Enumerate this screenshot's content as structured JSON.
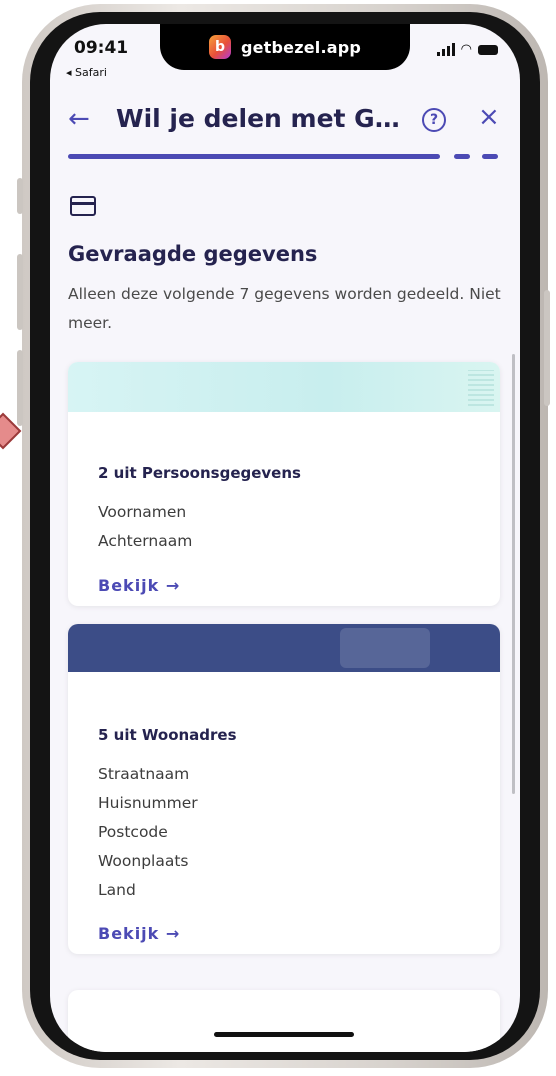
{
  "status_bar": {
    "time": "09:41",
    "back_app": "◂ Safari",
    "url_host": "getbezel.app"
  },
  "header": {
    "title": "Wil je delen met Gem...",
    "help_icon": "question-circle-icon",
    "close_icon": "close-icon",
    "back_icon": "arrow-left-icon"
  },
  "progress": {
    "completed_fraction": 0.86
  },
  "section": {
    "title": "Gevraagde gegevens",
    "description": "Alleen deze volgende 7 gegevens worden gedeeld. Niet meer."
  },
  "cards": [
    {
      "heading": "2 uit Persoonsgegevens",
      "items": [
        "Voornamen",
        "Achternaam"
      ],
      "link": "Bekijk →"
    },
    {
      "heading": "5 uit Woonadres",
      "items": [
        "Straatnaam",
        "Huisnummer",
        "Postcode",
        "Woonplaats",
        "Land"
      ],
      "link": "Bekijk →"
    }
  ],
  "colors": {
    "accent": "#4c4ab4",
    "heading": "#25234f",
    "banner_teal": "#c8eeee",
    "banner_navy": "#3c4d87"
  }
}
